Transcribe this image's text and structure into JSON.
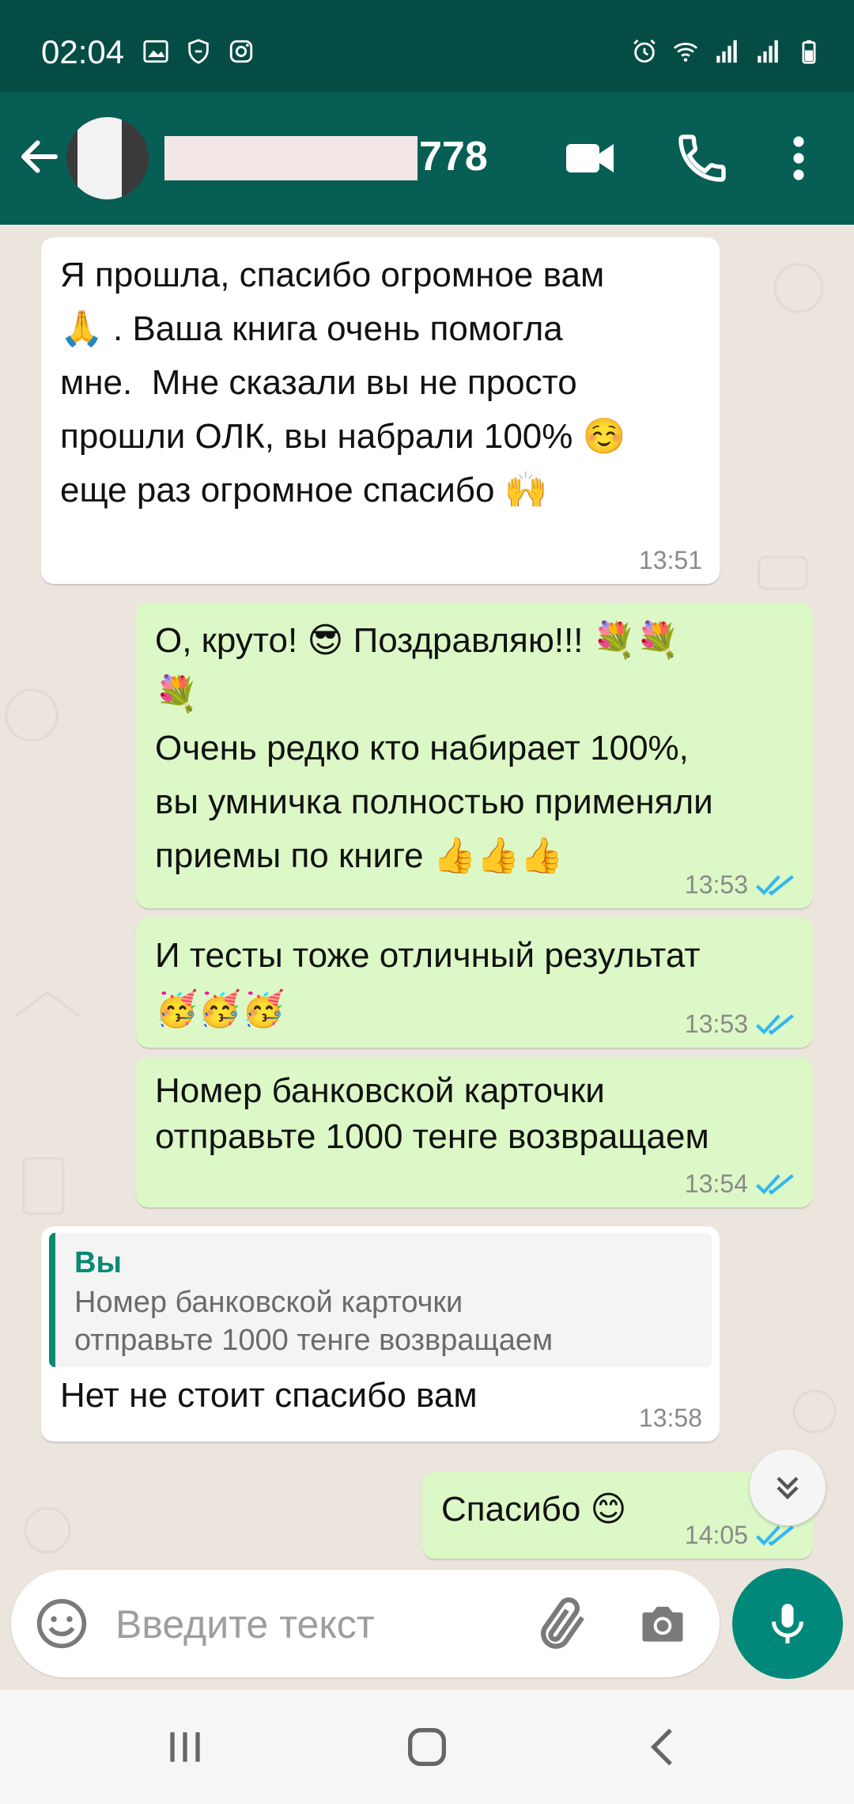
{
  "status_bar": {
    "time": "02:04",
    "icons": [
      "gallery-icon",
      "shield-icon",
      "instagram-icon",
      "alarm-icon",
      "wifi-icon",
      "signal-icon",
      "signal-icon",
      "battery-icon"
    ]
  },
  "header": {
    "contact_name_suffix": "778",
    "icons": [
      "back-arrow-icon",
      "video-call-icon",
      "phone-icon",
      "more-vertical-icon"
    ],
    "color": "#075e54"
  },
  "messages": [
    {
      "direction": "incoming",
      "text": "Я прошла, спасибо огромное вам\n🙏 . Ваша книга очень помогла\nмне.  Мне сказали вы не просто\nпрошли ОЛК, вы набрали 100% ☺️\nеще раз огромное спасибо 🙌",
      "time": "13:51"
    },
    {
      "direction": "outgoing",
      "text": "О, круто! 😎 Поздравляю!!! 💐💐\n💐\nОчень редко кто набирает 100%,\nвы умничка полностью применяли\nприемы по книге 👍👍👍",
      "time": "13:53"
    },
    {
      "direction": "outgoing",
      "text": "И тесты тоже отличный результат\n🥳🥳🥳",
      "time": "13:53"
    },
    {
      "direction": "outgoing",
      "text": "Номер банковской карточки\nотправьте 1000 тенге возвращаем",
      "time": "13:54"
    },
    {
      "direction": "incoming",
      "quote_author": "Вы",
      "quote_text": "Номер банковской карточки\nотправьте 1000 тенге возвращаем",
      "text": "Нет не стоит спасибо вам",
      "time": "13:58"
    },
    {
      "direction": "outgoing",
      "text": "Спасибо 😊",
      "time": "14:05"
    }
  ],
  "composer": {
    "placeholder": "Введите текст"
  },
  "colors": {
    "incoming_bubble": "#ffffff",
    "outgoing_bubble": "#dcf8c6",
    "read_ticks": "#34b7f1",
    "accent": "#00897b"
  }
}
